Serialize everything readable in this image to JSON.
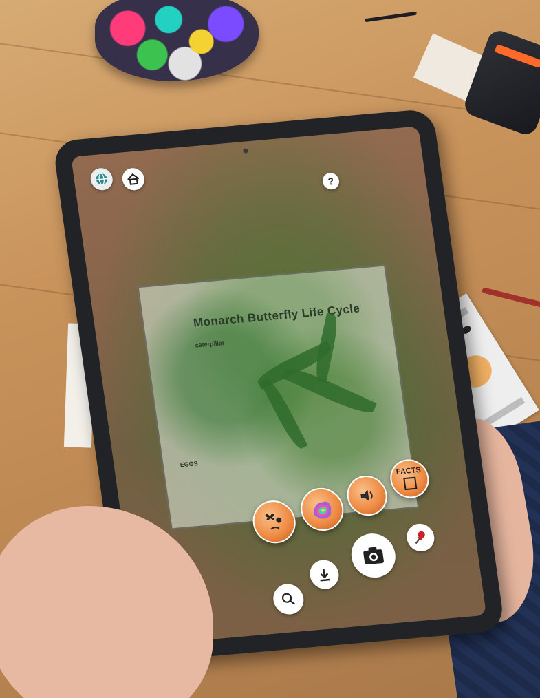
{
  "worksheet": {
    "title": "Monarch Butterfly Life Cycle",
    "labels": {
      "caterpillar": "caterpillar",
      "eggs": "EGGS"
    }
  },
  "toolbar": {
    "top": {
      "globe_icon": "globe-icon",
      "home_icon": "home-icon",
      "help_label": "?"
    },
    "ar_controls": {
      "facts_label": "FACTS",
      "sound_icon": "speaker-icon",
      "color_icon": "rainbow-splash-icon",
      "creature_icon": "butterfly-face-icon"
    },
    "bottom": {
      "camera_icon": "camera-icon",
      "pin_icon": "pushpin-icon",
      "download_icon": "download-icon",
      "search_icon": "magnifier-icon"
    }
  },
  "colors": {
    "accent_orange": "#ef8d46",
    "button_white": "#ffffff",
    "pin_red": "#c8232c"
  }
}
